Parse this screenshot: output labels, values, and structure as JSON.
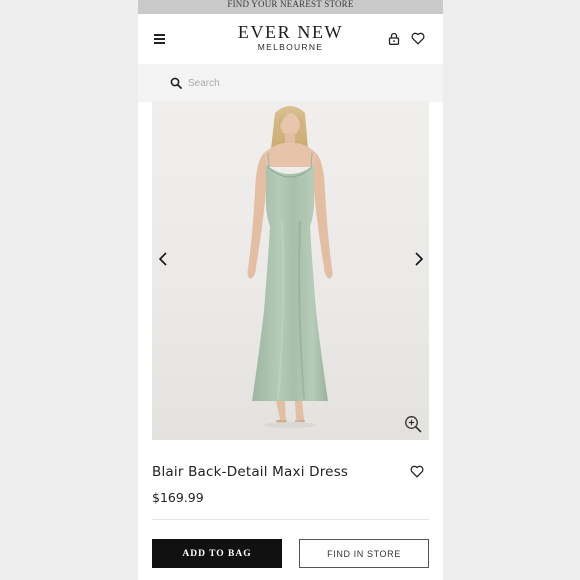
{
  "promo_bar": {
    "text": "FIND YOUR NEAREST STORE"
  },
  "header": {
    "brand": "EVER NEW",
    "location": "MELBOURNE",
    "icons": {
      "menu": "hamburger-menu-icon",
      "account": "lock-account-icon",
      "wishlist": "heart-icon"
    }
  },
  "search": {
    "placeholder": "Search",
    "value": "",
    "icon": "search-icon"
  },
  "gallery": {
    "prev_icon": "chevron-left-icon",
    "next_icon": "chevron-right-icon",
    "zoom_icon": "zoom-in-icon",
    "dress_color": "#a9c2ad"
  },
  "product": {
    "name": "Blair Back-Detail Maxi Dress",
    "price": "$169.99",
    "wishlist_icon": "heart-icon"
  },
  "actions": {
    "add_to_bag_label": "ADD TO BAG",
    "find_in_store_label": "FIND IN STORE"
  }
}
